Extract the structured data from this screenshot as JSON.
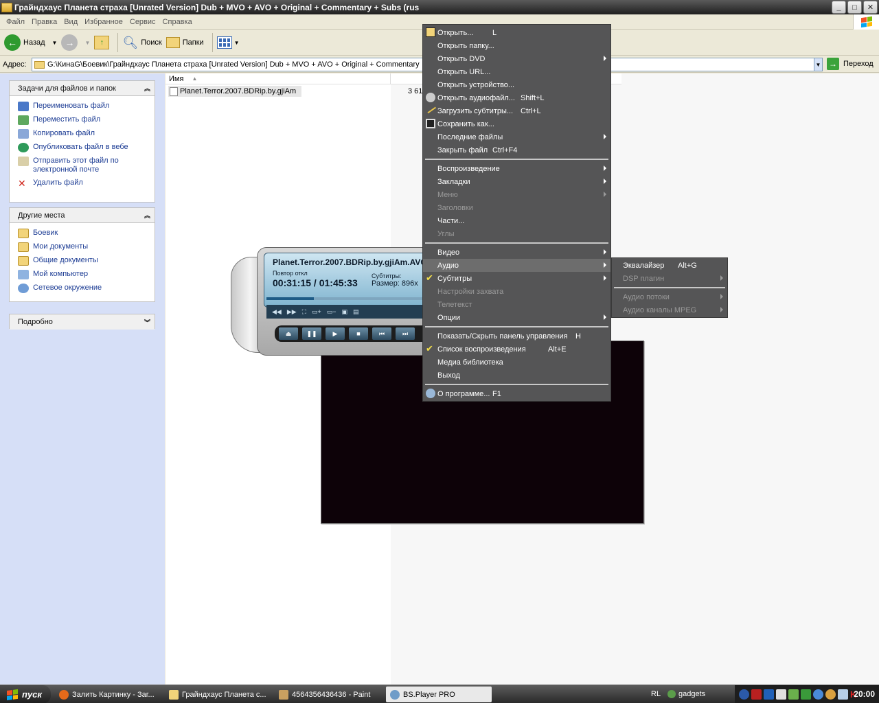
{
  "window": {
    "title": "Грайндхаус Планета страха [Unrated Version] Dub + MVO + AVO + Original + Commentary + Subs (rus"
  },
  "menubar": [
    "Файл",
    "Правка",
    "Вид",
    "Избранное",
    "Сервис",
    "Справка"
  ],
  "toolbar": {
    "back": "Назад",
    "search": "Поиск",
    "folders": "Папки"
  },
  "address": {
    "label": "Адрес:",
    "value": "G:\\КинаG\\Боевик\\Грайндхаус Планета страха [Unrated Version] Dub + MVO + AVO + Original + Commentary",
    "go": "Переход"
  },
  "tasks_panel": {
    "title": "Задачи для файлов и папок",
    "items": [
      "Переименовать файл",
      "Переместить файл",
      "Копировать файл",
      "Опубликовать файл в вебе",
      "Отправить этот файл по электронной почте",
      "Удалить файл"
    ]
  },
  "places_panel": {
    "title": "Другие места",
    "items": [
      "Боевик",
      "Мои документы",
      "Общие документы",
      "Мой компьютер",
      "Сетевое окружение"
    ]
  },
  "details_panel": {
    "title": "Подробно"
  },
  "file_list": {
    "column_name": "Имя",
    "file_name": "Planet.Terror.2007.BDRip.by.gjiAm",
    "file_size": "3 61"
  },
  "player": {
    "title": "Planet.Terror.2007.BDRip.by.gjiAm.AVC",
    "repeat": "Повтор откл",
    "time": "00:31:15 / 01:45:33",
    "subs_label": "Субтитры:",
    "size_label": "Размер: 896x",
    "progress": 0.3
  },
  "context_menu": {
    "group1": [
      {
        "label": "Открыть...",
        "shortcut": "L"
      },
      {
        "label": "Открыть папку..."
      },
      {
        "label": "Открыть DVD",
        "submenu": true
      },
      {
        "label": "Открыть URL..."
      },
      {
        "label": "Открыть устройство..."
      },
      {
        "label": "Открыть аудиофайл...",
        "shortcut": "Shift+L"
      },
      {
        "label": "Загрузить субтитры...",
        "shortcut": "Ctrl+L"
      },
      {
        "label": "Сохранить как..."
      },
      {
        "label": "Последние файлы",
        "submenu": true
      },
      {
        "label": "Закрыть файл",
        "shortcut": "Ctrl+F4"
      }
    ],
    "group2": [
      {
        "label": "Воспроизведение",
        "submenu": true
      },
      {
        "label": "Закладки",
        "submenu": true
      },
      {
        "label": "Меню",
        "submenu": true,
        "disabled": true
      },
      {
        "label": "Заголовки",
        "disabled": true
      },
      {
        "label": "Части..."
      },
      {
        "label": "Углы",
        "disabled": true
      }
    ],
    "group3": [
      {
        "label": "Видео",
        "submenu": true
      },
      {
        "label": "Аудио",
        "submenu": true,
        "highlighted": true
      },
      {
        "label": "Субтитры",
        "submenu": true
      },
      {
        "label": "Настройки захвата",
        "disabled": true
      },
      {
        "label": "Телетекст",
        "disabled": true
      },
      {
        "label": "Опции",
        "submenu": true
      }
    ],
    "group4": [
      {
        "label": "Показать/Скрыть панель управления",
        "shortcut": "H"
      },
      {
        "label": "Список воспроизведения",
        "shortcut": "Alt+E"
      },
      {
        "label": "Медиа библиотека"
      },
      {
        "label": "Выход"
      }
    ],
    "group5": [
      {
        "label": "О программе...",
        "shortcut": "F1"
      }
    ]
  },
  "audio_submenu": [
    {
      "label": "Эквалайзер",
      "shortcut": "Alt+G"
    },
    {
      "label": "DSP плагин",
      "submenu": true,
      "disabled": true
    },
    {
      "label": "Аудио потоки",
      "submenu": true,
      "disabled": true
    },
    {
      "label": "Аудио каналы MPEG",
      "submenu": true,
      "disabled": true
    }
  ],
  "taskbar": {
    "start": "пуск",
    "tasks": [
      "Залить Картинку - Заг...",
      "Грайндхаус Планета с...",
      "4564356436436 - Paint",
      "BS.Player PRO"
    ],
    "lang": "RL",
    "gadgets": "gadgets",
    "clock": "20:00"
  }
}
